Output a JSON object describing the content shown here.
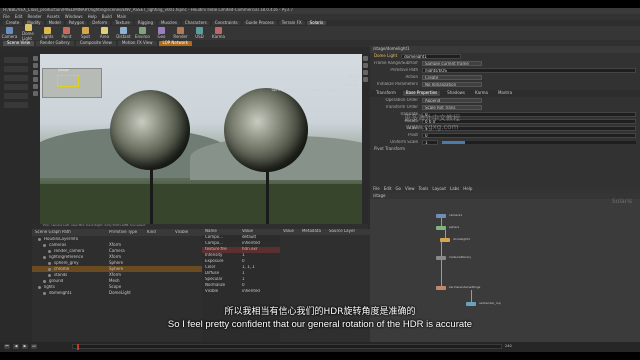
{
  "window": {
    "title": "H:/BBL/VEX_Class_production/PRELIMINARY/lighting/scenes/ENV_ASSET_lighting_v001.hipnc - Houdini Indie Limited-Commercial 18.0.416 - Py3.7"
  },
  "menus": [
    "File",
    "Edit",
    "Render",
    "Assets",
    "Windows",
    "Help",
    "Build",
    "Main"
  ],
  "shelf_tabs": [
    {
      "label": "Create",
      "active": false
    },
    {
      "label": "Modify",
      "active": false
    },
    {
      "label": "Model",
      "active": false
    },
    {
      "label": "Polygon",
      "active": false
    },
    {
      "label": "Deform",
      "active": false
    },
    {
      "label": "Texture",
      "active": false
    },
    {
      "label": "Rigging",
      "active": false
    },
    {
      "label": "Muscles",
      "active": false
    },
    {
      "label": "Characters",
      "active": false
    },
    {
      "label": "Constraints",
      "active": false
    },
    {
      "label": "Guide Process",
      "active": false
    },
    {
      "label": "Terrain FX",
      "active": false
    },
    {
      "label": "Solaris",
      "active": true
    }
  ],
  "shelf_tools": [
    {
      "label": "Camera",
      "color": "#6b8ebf"
    },
    {
      "label": "Dome Light",
      "color": "#d9c36a"
    },
    {
      "label": "Lights",
      "color": "#e0b84a"
    },
    {
      "label": "Point",
      "color": "#c96b5a"
    },
    {
      "label": "Spot",
      "color": "#d6a64e"
    },
    {
      "label": "Area",
      "color": "#e3cf78"
    },
    {
      "label": "Distant",
      "color": "#8fb1d6"
    },
    {
      "label": "Environ",
      "color": "#7fa37b"
    },
    {
      "label": "Geo",
      "color": "#9a7fc0"
    },
    {
      "label": "Render",
      "color": "#b57a4f"
    },
    {
      "label": "USD",
      "color": "#5a9fa0"
    },
    {
      "label": "Karma",
      "color": "#c0666b"
    }
  ],
  "pane_tabs": [
    {
      "label": "Scene View",
      "active": true,
      "orange": false
    },
    {
      "label": "Render Gallery",
      "active": false,
      "orange": false
    },
    {
      "label": "Composite View",
      "active": false,
      "orange": false
    },
    {
      "label": "Motion FX View",
      "active": false,
      "orange": false
    },
    {
      "label": "LOP Network",
      "active": false,
      "orange": true
    }
  ],
  "viewport": {
    "camera_name": "/stage",
    "hud": [
      "Persp",
      "Cam",
      "No cam",
      "persp1",
      "1/2"
    ],
    "hud_right": "Opts [Full] Optic [View] Stage(1) [Ortho]",
    "status": "Pick: camera   Left: view   Mid: track   Right: dolly   Shift+LMB: box select"
  },
  "parm_panel": {
    "path": "/stage/domelight1",
    "node_type": "Dome Light",
    "node_name": "domelight1",
    "rows": [
      {
        "label": "Frame Range/Subframes",
        "kind": "menu",
        "value": "Sample current frame"
      },
      {
        "label": "Primitive Path",
        "kind": "field",
        "value": "/lights/$OS"
      },
      {
        "label": "Action",
        "kind": "menu",
        "value": "Create"
      },
      {
        "label": "Initialize Parameters",
        "kind": "menu",
        "value": "No Initialization"
      }
    ],
    "tabs": [
      {
        "label": "Transform",
        "active": false
      },
      {
        "label": "Base Properties",
        "active": true
      },
      {
        "label": "Shadows",
        "active": false
      },
      {
        "label": "Karma",
        "active": false
      },
      {
        "label": "Mantra",
        "active": false
      }
    ],
    "xform_rows": [
      {
        "label": "Operation Order",
        "kind": "menu",
        "value": "Append"
      },
      {
        "label": "Transform Order",
        "kind": "menu",
        "value": "Scale Rot Trans"
      },
      {
        "label": "Translate",
        "kind": "field",
        "value": "0"
      },
      {
        "label": "Rotate",
        "kind": "field",
        "value": "0   0   0"
      },
      {
        "label": "Scale",
        "kind": "field",
        "value": "1"
      },
      {
        "label": "Pivot",
        "kind": "field",
        "value": "0"
      },
      {
        "label": "Uniform Scale",
        "kind": "slider",
        "value": "1",
        "fill": 0.12
      }
    ],
    "section": "Pivot Transform"
  },
  "watermark": {
    "line1": "更多海外中文教程",
    "line2": "www.cgxg.com"
  },
  "node_graph": {
    "path": "/stage",
    "tabs": [
      "File",
      "Edit",
      "Go",
      "View",
      "Tools",
      "Layout",
      "Labs",
      "Help"
    ],
    "context_label": "Solaris",
    "nodes": [
      {
        "label": "camera1",
        "color": "#6f8fb8"
      },
      {
        "label": "sphere",
        "color": "#7fb37f"
      },
      {
        "label": "domelight1",
        "color": "#d6a64e"
      },
      {
        "label": "materiallibrary",
        "color": "#8a8a8a"
      },
      {
        "label": "karmarendersettings",
        "color": "#c08a6a"
      },
      {
        "label": "usdrender_rop",
        "color": "#6aa0c0"
      }
    ]
  },
  "scene_graph": {
    "headers": [
      "Scene Graph Path",
      "Primitive Type",
      "Kind",
      "Visible"
    ],
    "rows": [
      {
        "name": "HoudiniLayerInfo",
        "type": "",
        "indent": 0,
        "selected": false
      },
      {
        "name": "cameras",
        "type": "Xform",
        "indent": 1,
        "selected": false
      },
      {
        "name": "render_camera",
        "type": "Camera",
        "indent": 2,
        "selected": false
      },
      {
        "name": "lightingreference",
        "type": "Xform",
        "indent": 1,
        "selected": false
      },
      {
        "name": "sphere_grey",
        "type": "Sphere",
        "indent": 2,
        "selected": false
      },
      {
        "name": "chrome",
        "type": "Sphere",
        "indent": 2,
        "selected": true
      },
      {
        "name": "stands",
        "type": "Xform",
        "indent": 2,
        "selected": false
      },
      {
        "name": "ground",
        "type": "Mesh",
        "indent": 1,
        "selected": false
      },
      {
        "name": "lights",
        "type": "Scope",
        "indent": 0,
        "selected": false
      },
      {
        "name": "domelight1",
        "type": "DomeLight",
        "indent": 1,
        "selected": false
      }
    ]
  },
  "properties": {
    "headers": [
      "Name",
      "Value"
    ],
    "rows": [
      {
        "name": "Compo...",
        "value": "default",
        "selected": false
      },
      {
        "name": "Compo...",
        "value": "inherited",
        "selected": false
      },
      {
        "name": "texture:file",
        "value": "hdri.exr",
        "selected": true
      },
      {
        "name": "Intensity",
        "value": "1",
        "selected": false
      },
      {
        "name": "Exposure",
        "value": "0",
        "selected": false
      },
      {
        "name": "Color",
        "value": "1, 1, 1",
        "selected": false
      },
      {
        "name": "Diffuse",
        "value": "1",
        "selected": false
      },
      {
        "name": "Specular",
        "value": "1",
        "selected": false
      },
      {
        "name": "Normalize",
        "value": "0",
        "selected": false
      },
      {
        "name": "Visible",
        "value": "inherited",
        "selected": false
      }
    ]
  },
  "attrs": {
    "headers": [
      "Value",
      "Metadata",
      "Source Layer"
    ]
  },
  "timeline": {
    "frame": "1",
    "end": "240",
    "buttons": [
      "⏮",
      "◀",
      "▶",
      "⏭"
    ]
  },
  "subtitles": {
    "cn": "所以我相当有信心我们的HDR旋转角度是准确的",
    "en": "So I feel pretty confident that our general rotation of the HDR is accurate"
  }
}
